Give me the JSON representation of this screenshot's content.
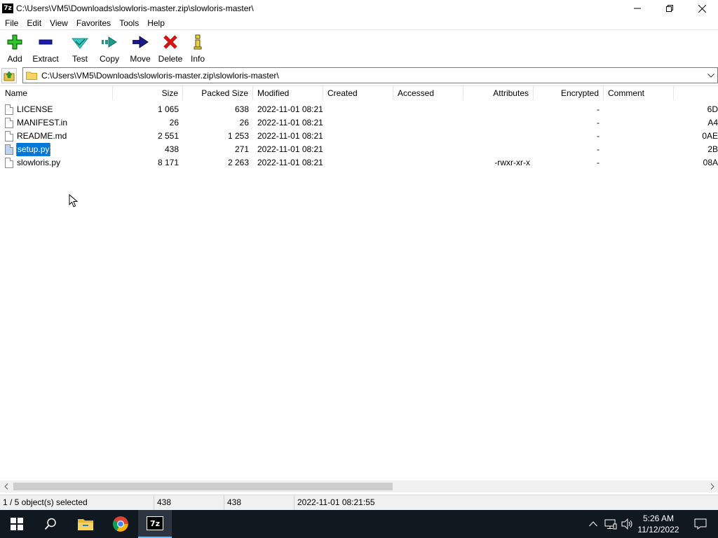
{
  "window": {
    "title": "C:\\Users\\VM5\\Downloads\\slowloris-master.zip\\slowloris-master\\",
    "app_icon_text": "7z"
  },
  "menu": [
    "File",
    "Edit",
    "View",
    "Favorites",
    "Tools",
    "Help"
  ],
  "toolbar": {
    "add": "Add",
    "extract": "Extract",
    "test": "Test",
    "copy": "Copy",
    "move": "Move",
    "delete": "Delete",
    "info": "Info"
  },
  "address": {
    "path": "C:\\Users\\VM5\\Downloads\\slowloris-master.zip\\slowloris-master\\"
  },
  "columns": {
    "name": "Name",
    "size": "Size",
    "packed": "Packed Size",
    "modified": "Modified",
    "created": "Created",
    "accessed": "Accessed",
    "attributes": "Attributes",
    "encrypted": "Encrypted",
    "comment": "Comment"
  },
  "files": [
    {
      "name": "LICENSE",
      "size": "1 065",
      "packed": "638",
      "modified": "2022-11-01 08:21",
      "attributes": "",
      "encrypted": "-",
      "crc": "6D"
    },
    {
      "name": "MANIFEST.in",
      "size": "26",
      "packed": "26",
      "modified": "2022-11-01 08:21",
      "attributes": "",
      "encrypted": "-",
      "crc": "A4"
    },
    {
      "name": "README.md",
      "size": "2 551",
      "packed": "1 253",
      "modified": "2022-11-01 08:21",
      "attributes": "",
      "encrypted": "-",
      "crc": "0AE"
    },
    {
      "name": "setup.py",
      "size": "438",
      "packed": "271",
      "modified": "2022-11-01 08:21",
      "attributes": "",
      "encrypted": "-",
      "crc": "2B"
    },
    {
      "name": "slowloris.py",
      "size": "8 171",
      "packed": "2 263",
      "modified": "2022-11-01 08:21",
      "attributes": "-rwxr-xr-x",
      "encrypted": "-",
      "crc": "08A"
    }
  ],
  "status": {
    "selection": "1 / 5 object(s) selected",
    "size": "438",
    "packed": "438",
    "modified": "2022-11-01 08:21:55"
  },
  "taskbar": {
    "time": "5:26 AM",
    "date": "11/12/2022",
    "app_7z_label": "7z"
  },
  "colors": {
    "selection": "#0078d7",
    "taskbar": "#101820"
  }
}
